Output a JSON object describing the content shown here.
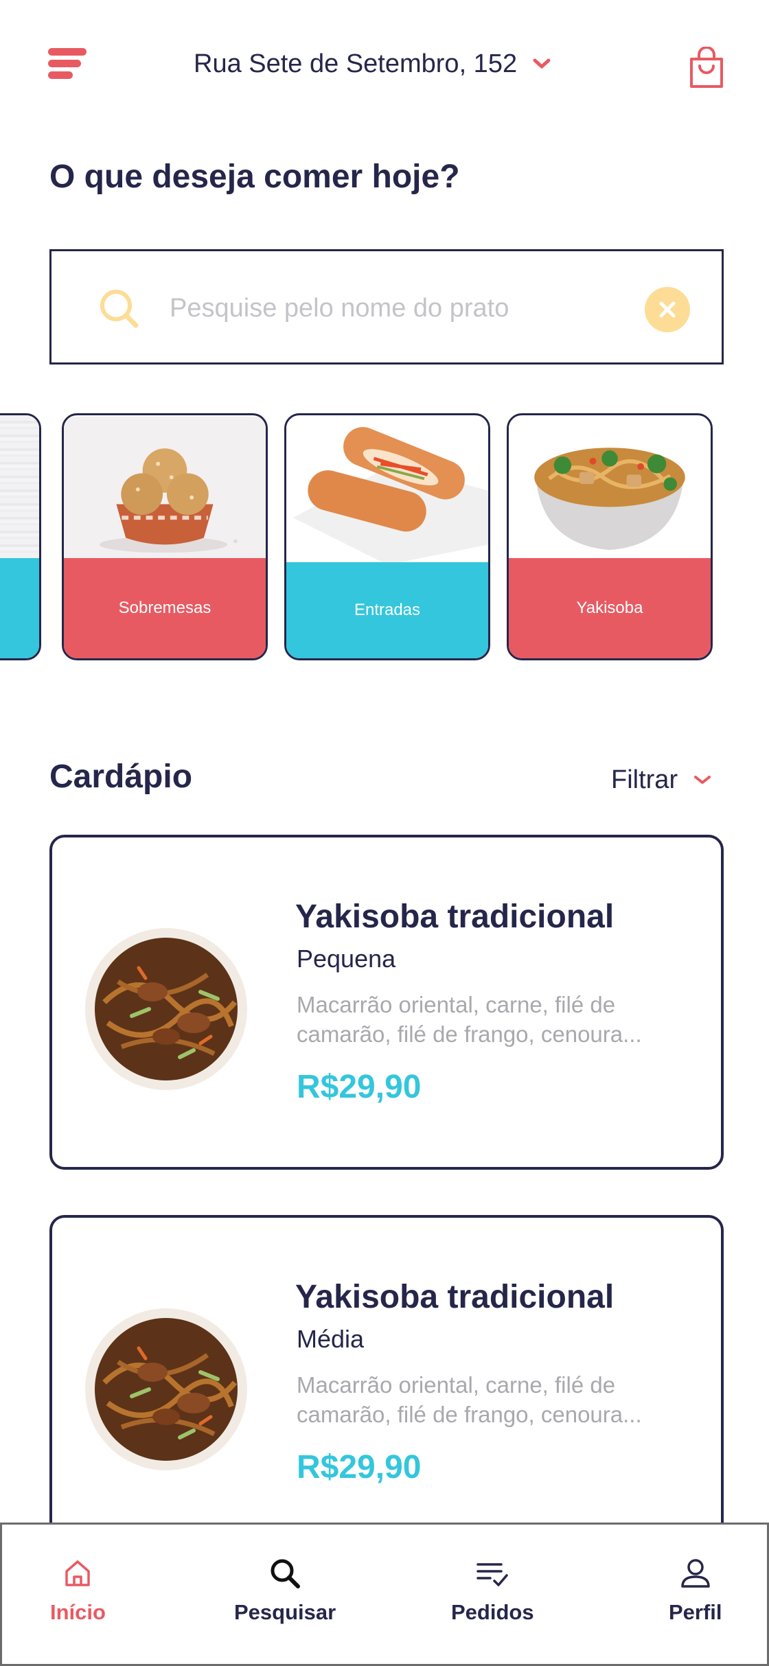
{
  "header": {
    "address": "Rua Sete de Setembro, 152",
    "menu_icon": "hamburger-menu-icon",
    "address_icon": "chevron-down-icon",
    "cart_icon": "shopping-bag-icon"
  },
  "title": "O que deseja comer hoje?",
  "search": {
    "placeholder": "Pesquise pelo nome do prato",
    "value": "",
    "icon": "search-icon",
    "clear_icon": "close-icon"
  },
  "categories": [
    {
      "label": "",
      "color": "#34c6dc"
    },
    {
      "label": "Sobremesas",
      "color": "#e85a62"
    },
    {
      "label": "Entradas",
      "color": "#34c6dc"
    },
    {
      "label": "Yakisoba",
      "color": "#e85a62"
    }
  ],
  "menu": {
    "title": "Cardápio",
    "filter_label": "Filtrar",
    "items": [
      {
        "name": "Yakisoba tradicional",
        "size": "Pequena",
        "description": "Macarrão oriental, carne, filé de camarão, filé de frango, cenoura...",
        "price": "R$29,90"
      },
      {
        "name": "Yakisoba tradicional",
        "size": "Média",
        "description": "Macarrão oriental, carne, filé de camarão, filé de frango, cenoura...",
        "price": "R$29,90"
      }
    ]
  },
  "tabs": [
    {
      "label": "Início",
      "icon": "home-icon",
      "active": true
    },
    {
      "label": "Pesquisar",
      "icon": "search-icon",
      "active": false
    },
    {
      "label": "Pedidos",
      "icon": "orders-list-icon",
      "active": false
    },
    {
      "label": "Perfil",
      "icon": "user-icon",
      "active": false
    }
  ],
  "colors": {
    "primary_red": "#e85a62",
    "accent_cyan": "#34c6dc",
    "navy": "#25264a",
    "yellow": "#fddc95",
    "muted_text": "#a8a8ad"
  }
}
